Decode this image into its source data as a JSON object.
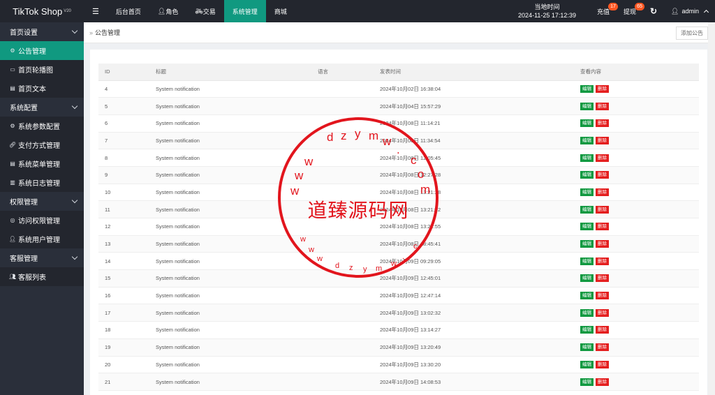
{
  "app": {
    "logo": "TikTok Shop",
    "version": "V20"
  },
  "sidebar": {
    "groups": [
      {
        "label": "首页设置",
        "items": [
          {
            "label": "公告管理",
            "icon": "gear-icon",
            "active": true
          },
          {
            "label": "首页轮播图",
            "icon": "image-icon"
          },
          {
            "label": "首页文本",
            "icon": "document-icon"
          }
        ]
      },
      {
        "label": "系统配置",
        "items": [
          {
            "label": "系统参数配置",
            "icon": "gear-icon"
          },
          {
            "label": "支付方式管理",
            "icon": "link-icon"
          },
          {
            "label": "系统菜单管理",
            "icon": "menu-icon"
          },
          {
            "label": "系统日志管理",
            "icon": "log-icon"
          }
        ]
      },
      {
        "label": "权限管理",
        "items": [
          {
            "label": "访问权限管理",
            "icon": "shield-icon"
          },
          {
            "label": "系统用户管理",
            "icon": "user-icon"
          }
        ]
      },
      {
        "label": "客服管理",
        "items": [
          {
            "label": "客服列表",
            "icon": "users-icon"
          }
        ]
      }
    ]
  },
  "topnav": {
    "items": [
      "后台首页",
      "角色",
      "交易",
      "系统管理",
      "商城"
    ],
    "active_index": 3
  },
  "header": {
    "time_label": "当地时间",
    "time_value": "2024-11-25 17:12:39",
    "recharge_label": "充值",
    "recharge_badge": "17",
    "withdraw_label": "提现",
    "withdraw_badge": "65",
    "user": "admin"
  },
  "breadcrumb": {
    "label": "公告管理",
    "add_button": "添加公告"
  },
  "table": {
    "headers": [
      "ID",
      "标题",
      "语言",
      "发表时间",
      "查看内容"
    ],
    "edit_label": "编辑",
    "delete_label": "删除",
    "rows": [
      {
        "id": "4",
        "title": "System notification",
        "lang": "",
        "time": "2024年10月02日 16:38:04"
      },
      {
        "id": "5",
        "title": "System notification",
        "lang": "",
        "time": "2024年10月04日 15:57:29"
      },
      {
        "id": "6",
        "title": "System notification",
        "lang": "",
        "time": "2024年10月08日 11:14:21"
      },
      {
        "id": "7",
        "title": "System notification",
        "lang": "",
        "time": "2024年10月08日 11:34:54"
      },
      {
        "id": "8",
        "title": "System notification",
        "lang": "",
        "time": "2024年10月08日 12:05:45"
      },
      {
        "id": "9",
        "title": "System notification",
        "lang": "",
        "time": "2024年10月08日 12:27:28"
      },
      {
        "id": "10",
        "title": "System notification",
        "lang": "",
        "time": "2024年10月08日 13:21:28"
      },
      {
        "id": "11",
        "title": "System notification",
        "lang": "",
        "time": "2024年10月08日 13:21:52"
      },
      {
        "id": "12",
        "title": "System notification",
        "lang": "",
        "time": "2024年10月08日 13:22:55"
      },
      {
        "id": "13",
        "title": "System notification",
        "lang": "",
        "time": "2024年10月08日 18:45:41"
      },
      {
        "id": "14",
        "title": "System notification",
        "lang": "",
        "time": "2024年10月09日 09:29:05"
      },
      {
        "id": "15",
        "title": "System notification",
        "lang": "",
        "time": "2024年10月09日 12:45:01"
      },
      {
        "id": "16",
        "title": "System notification",
        "lang": "",
        "time": "2024年10月09日 12:47:14"
      },
      {
        "id": "17",
        "title": "System notification",
        "lang": "",
        "time": "2024年10月09日 13:02:32"
      },
      {
        "id": "18",
        "title": "System notification",
        "lang": "",
        "time": "2024年10月09日 13:14:27"
      },
      {
        "id": "19",
        "title": "System notification",
        "lang": "",
        "time": "2024年10月09日 13:20:49"
      },
      {
        "id": "20",
        "title": "System notification",
        "lang": "",
        "time": "2024年10月09日 13:30:20"
      },
      {
        "id": "21",
        "title": "System notification",
        "lang": "",
        "time": "2024年10月09日 14:08:53"
      }
    ]
  },
  "watermark": {
    "main": "道臻源码网",
    "ring_text": "dzymw.com"
  },
  "colors": {
    "accent": "#109980",
    "topbar": "#23262e",
    "sidebar": "#2a2f3a",
    "edit": "#109940",
    "delete": "#e41e1e",
    "stamp": "#e2151d"
  }
}
